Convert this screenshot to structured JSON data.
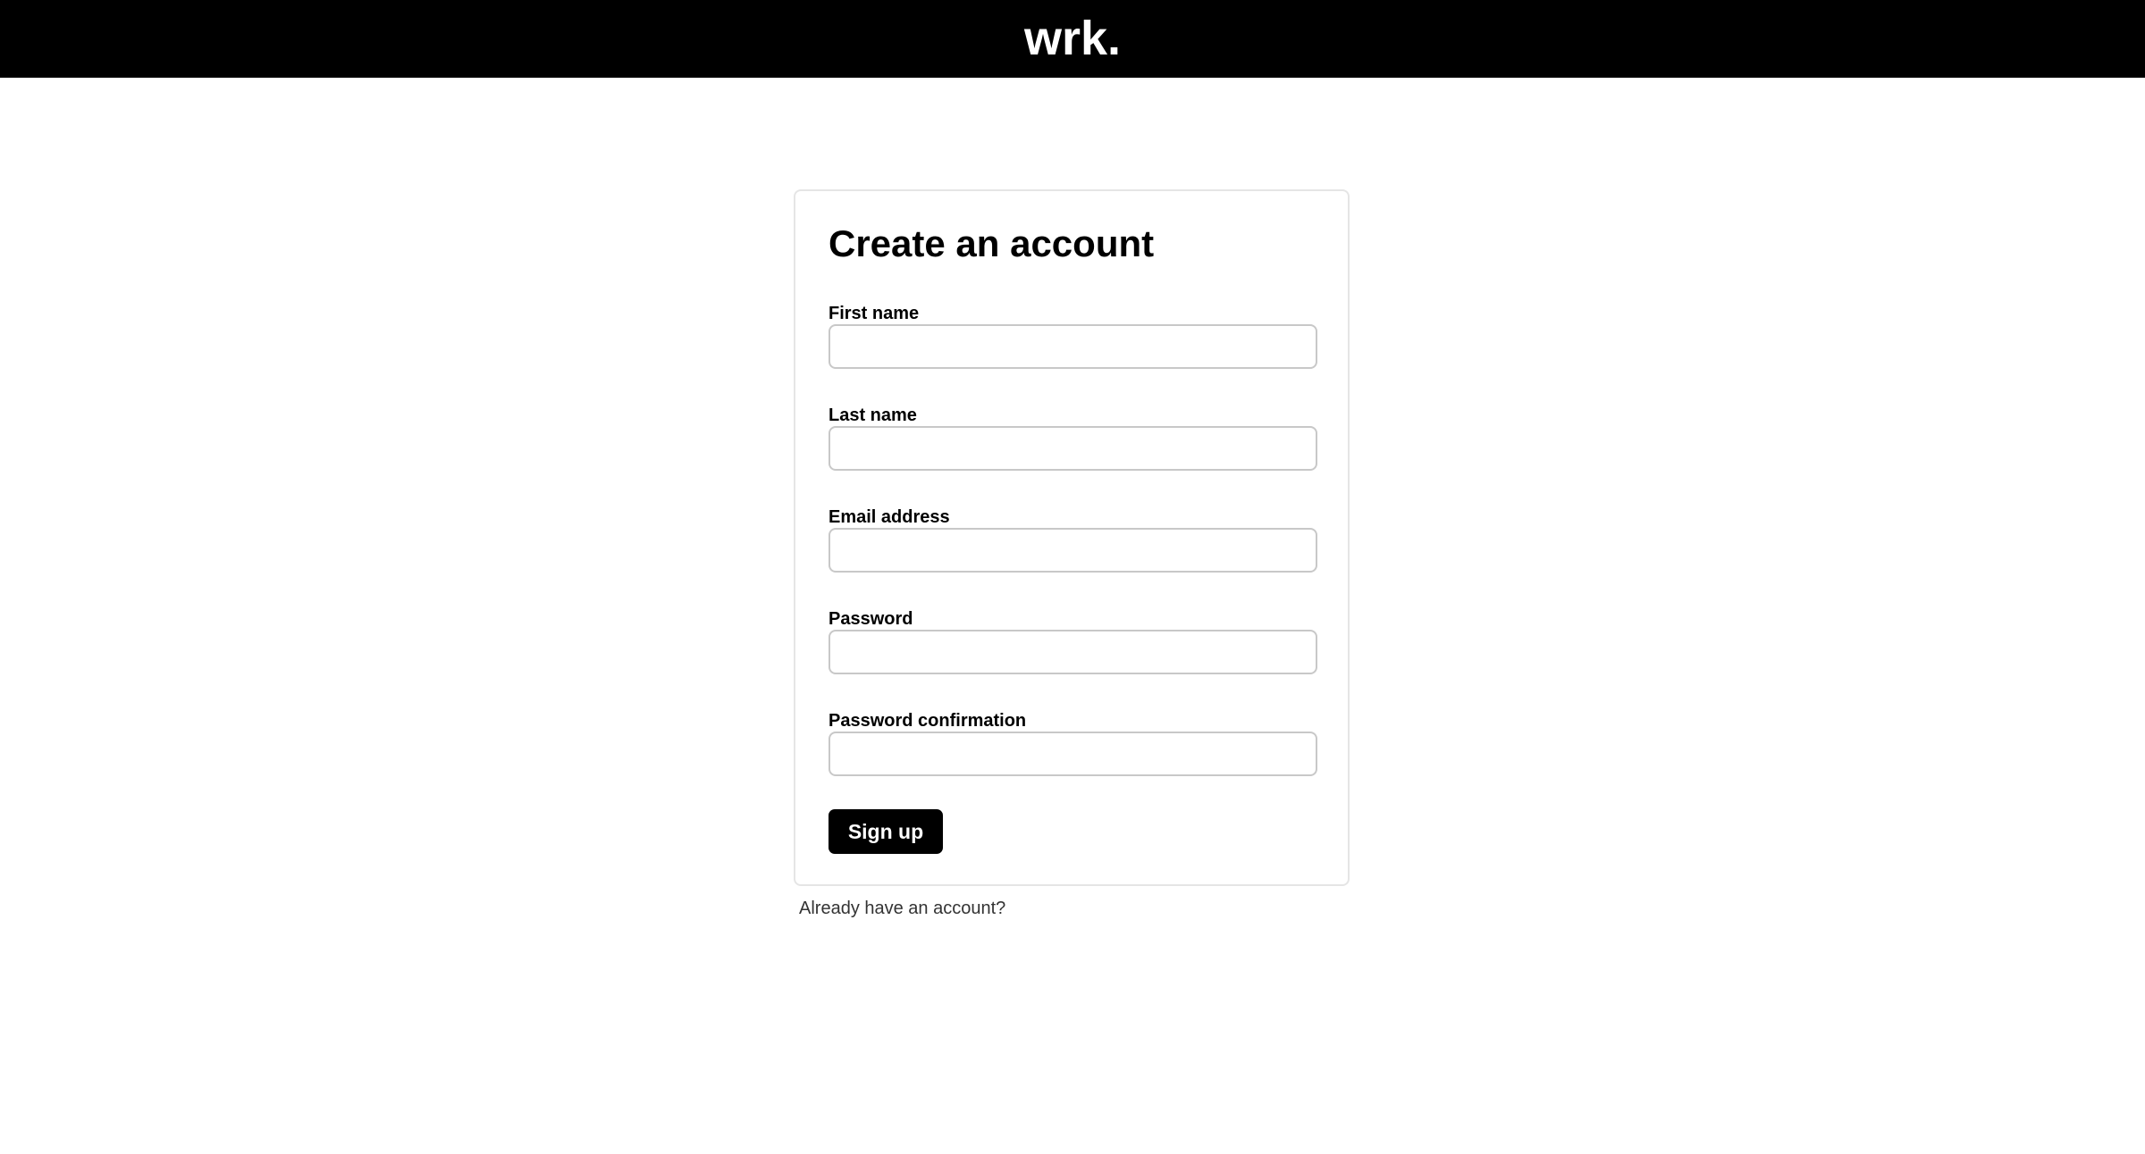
{
  "header": {
    "logo_text": "wrk."
  },
  "signup_form": {
    "title": "Create an account",
    "fields": [
      {
        "label": "First name",
        "value": "",
        "placeholder": ""
      },
      {
        "label": "Last name",
        "value": "",
        "placeholder": ""
      },
      {
        "label": "Email address",
        "value": "",
        "placeholder": ""
      },
      {
        "label": "Password",
        "value": "",
        "placeholder": ""
      },
      {
        "label": "Password confirmation",
        "value": "",
        "placeholder": ""
      }
    ],
    "submit_label": "Sign up"
  },
  "footer_links": {
    "login_link": "Already have an account?"
  },
  "colors": {
    "header_bg": "#000000",
    "button_bg": "#000000",
    "card_border": "#e5e5e5",
    "input_border": "#c8c8c8"
  }
}
